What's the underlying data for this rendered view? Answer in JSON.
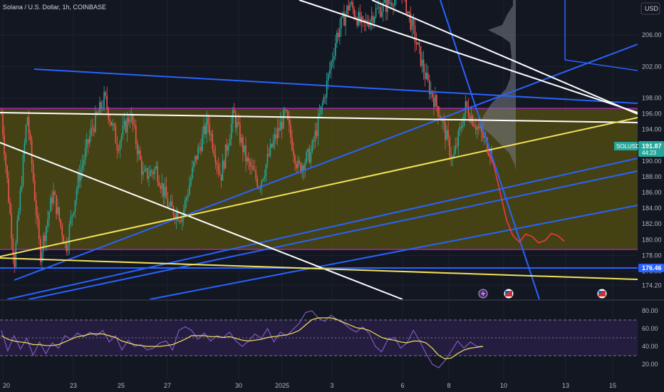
{
  "header": {
    "symbol_title": "Solana / U.S. Dollar, 1h, COINBASE",
    "currency": "USD"
  },
  "colors": {
    "background": "#131722",
    "grid": "#1e222d",
    "zone_fill": "#4d4a12",
    "zone_border": "#9c27b0",
    "up": "#26a69a",
    "down": "#ef5350",
    "trend_blue": "#2962ff",
    "trend_white": "#ffffff",
    "trend_yellow": "#f2e15b",
    "forecast": "#f23645",
    "rsi": "#7e57c2",
    "rsi_ma": "#f2e15b",
    "rsi_band": "#2a1f47"
  },
  "price_axis": {
    "ticks": [
      "206.00",
      "202.00",
      "198.00",
      "196.00",
      "194.00",
      "190.00",
      "188.00",
      "186.00",
      "184.00",
      "182.00",
      "180.00",
      "178.00",
      "176.00",
      "174.20"
    ]
  },
  "last_price": {
    "symbol": "SOLUSD",
    "price": "191.87",
    "countdown": "44:23"
  },
  "level_label": "176.46",
  "time_axis": {
    "labels": [
      "20",
      "23",
      "25",
      "27",
      "30",
      "2025",
      "3",
      "6",
      "8",
      "10",
      "13",
      "15"
    ]
  },
  "rsi_axis": {
    "ticks": [
      "80.00",
      "60.00",
      "40.00",
      "20.00"
    ]
  },
  "events": [
    {
      "icon": "lightning-icon"
    },
    {
      "icon": "us-flag-icon"
    },
    {
      "icon": "us-flag-icon"
    }
  ],
  "chart_data": {
    "type": "candlestick",
    "title": "Solana / U.S. Dollar, 1h, COINBASE",
    "ylabel": "USD",
    "ylim": [
      173.5,
      210
    ],
    "x_dates": [
      "20",
      "23",
      "25",
      "27",
      "30",
      "2025",
      "3",
      "6",
      "8",
      "10",
      "13",
      "15"
    ],
    "price_path": [
      [
        "20",
        196
      ],
      [
        "20",
        177
      ],
      [
        "21",
        196
      ],
      [
        "21",
        178
      ],
      [
        "22",
        186
      ],
      [
        "22",
        179
      ],
      [
        "23",
        188
      ],
      [
        "23",
        194
      ],
      [
        "24",
        198
      ],
      [
        "24",
        192
      ],
      [
        "25",
        196
      ],
      [
        "25",
        188
      ],
      [
        "26",
        189
      ],
      [
        "26",
        184
      ],
      [
        "27",
        183
      ],
      [
        "27",
        190
      ],
      [
        "28",
        195
      ],
      [
        "28",
        188
      ],
      [
        "29",
        196
      ],
      [
        "29",
        190
      ],
      [
        "30",
        187
      ],
      [
        "30",
        192
      ],
      [
        "31",
        196
      ],
      [
        "31",
        189
      ],
      [
        "2025",
        191
      ],
      [
        "2025",
        198
      ],
      [
        "1",
        206
      ],
      [
        "2",
        210
      ],
      [
        "3",
        207
      ],
      [
        "4",
        209
      ],
      [
        "5",
        210
      ],
      [
        "6",
        212
      ],
      [
        "7",
        206
      ],
      [
        "7",
        200
      ],
      [
        "8",
        196
      ],
      [
        "8",
        190
      ],
      [
        "8",
        197
      ],
      [
        "8",
        194
      ],
      [
        "9",
        191
      ]
    ],
    "levels": {
      "zone_top": 196.5,
      "zone_bottom": 178.8,
      "support": 176.46,
      "last": 191.87
    },
    "forecast_path": [
      191.5,
      189.5,
      186,
      182.5,
      180.5,
      179.7,
      180.7,
      180.4,
      179.6,
      179.9,
      180.8,
      180.5,
      179.8
    ],
    "rsi": {
      "ylim": [
        10,
        85
      ],
      "bands": [
        70,
        30
      ],
      "values": [
        58,
        35,
        52,
        37,
        49,
        30,
        45,
        32,
        44,
        38,
        52,
        48,
        55,
        51,
        56,
        52,
        58,
        45,
        52,
        36,
        47,
        40,
        42,
        36,
        38,
        44,
        46,
        36,
        58,
        62,
        58,
        48,
        55,
        46,
        52,
        50,
        56,
        46,
        40,
        46,
        54,
        49,
        60,
        45,
        56,
        52,
        59,
        66,
        78,
        80,
        72,
        68,
        75,
        70,
        66,
        60,
        56,
        62,
        55,
        40,
        34,
        48,
        50,
        38,
        44,
        58,
        46,
        32,
        20,
        16,
        24,
        35,
        46,
        38,
        45,
        40,
        40
      ],
      "ma": [
        52,
        48,
        46,
        45,
        44,
        42,
        42,
        41,
        41,
        42,
        45,
        48,
        51,
        52,
        54,
        54,
        54,
        52,
        50,
        46,
        44,
        42,
        41,
        40,
        40,
        40,
        41,
        42,
        45,
        48,
        52,
        52,
        52,
        51,
        51,
        50,
        51,
        49,
        47,
        46,
        47,
        48,
        50,
        51,
        52,
        53,
        55,
        58,
        64,
        70,
        72,
        72,
        72,
        70,
        67,
        64,
        61,
        60,
        58,
        54,
        50,
        48,
        47,
        45,
        44,
        46,
        46,
        44,
        38,
        30,
        26,
        27,
        32,
        36,
        38,
        39,
        40
      ]
    }
  }
}
